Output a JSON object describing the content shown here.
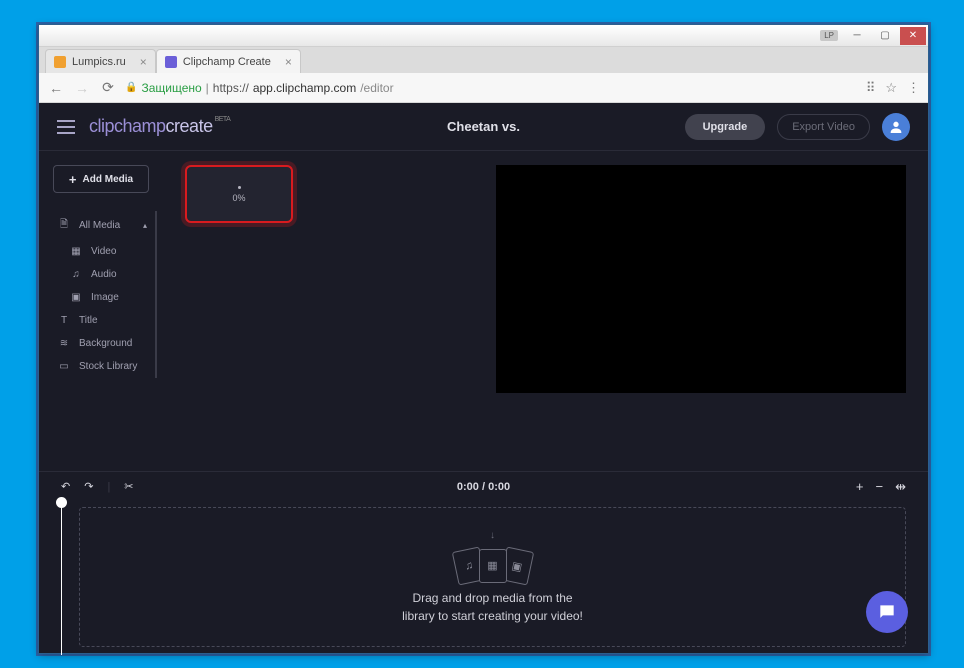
{
  "window": {
    "lp_badge": "LP",
    "tabs": [
      {
        "title": "Lumpics.ru",
        "favicon": "#f0a030"
      },
      {
        "title": "Clipchamp Create",
        "favicon": "#6b5fd8"
      }
    ],
    "secure_label": "Защищено",
    "url_scheme": "https://",
    "url_host": "app.clipchamp.com",
    "url_path": "/editor"
  },
  "header": {
    "logo_part1": "clipchamp",
    "logo_part2": "create",
    "logo_beta": "BETA",
    "project_title": "Cheetan vs.",
    "upgrade_label": "Upgrade",
    "export_label": "Export Video"
  },
  "sidebar": {
    "add_media_label": "Add Media",
    "items": [
      {
        "label": "All Media",
        "icon": "file"
      },
      {
        "label": "Video",
        "icon": "film"
      },
      {
        "label": "Audio",
        "icon": "music"
      },
      {
        "label": "Image",
        "icon": "image"
      },
      {
        "label": "Title",
        "icon": "text"
      },
      {
        "label": "Background",
        "icon": "layers"
      },
      {
        "label": "Stock Library",
        "icon": "library"
      }
    ]
  },
  "media": {
    "upload_progress": "0%"
  },
  "timeline": {
    "time_display": "0:00 / 0:00",
    "dropzone_line1": "Drag and drop media from the",
    "dropzone_line2": "library to start creating your video!"
  }
}
